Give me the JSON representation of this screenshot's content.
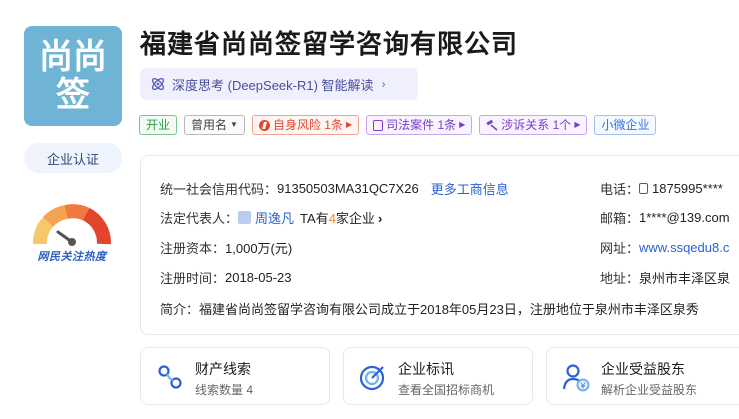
{
  "logo": {
    "text": "尚尚签"
  },
  "cert_label": "企业认证",
  "heat_label": "网民关注热度",
  "company_name": "福建省尚尚签留学咨询有限公司",
  "ai": {
    "label": "深度思考 (DeepSeek-R1) 智能解读",
    "chevron": "›"
  },
  "tags": {
    "status": "开业",
    "former_name": "曾用名",
    "risk": "自身风险 1条",
    "judicial": "司法案件 1条",
    "litigation": "涉诉关系 1个",
    "scale": "小微企业"
  },
  "info": {
    "credit_code_label": "统一社会信用代码：",
    "credit_code": "91350503MA31QC7X26",
    "more_link": "更多工商信息",
    "legal_rep_label": "法定代表人：",
    "legal_rep": "周逸凡",
    "ta_prefix": "TA有",
    "ta_count": "4",
    "ta_suffix": "家企业",
    "capital_label": "注册资本：",
    "capital": "1,000万(元)",
    "reg_date_label": "注册时间：",
    "reg_date": "2018-05-23",
    "phone_label": "电话：",
    "phone": "1875995****",
    "email_label": "邮箱：",
    "email": "1****@139.com",
    "website_label": "网址：",
    "website": "www.ssqedu8.c",
    "address_label": "地址：",
    "address": "泉州市丰泽区泉",
    "intro_label": "简介：",
    "intro": "福建省尚尚签留学咨询有限公司成立于2018年05月23日，注册地位于泉州市丰泽区泉秀"
  },
  "features": [
    {
      "title": "财产线索",
      "sub": "线索数量 4"
    },
    {
      "title": "企业标讯",
      "sub": "查看全国招标商机"
    },
    {
      "title": "企业受益股东",
      "sub": "解析企业受益股东"
    }
  ],
  "colors": {
    "accent": "#2a62d6",
    "logo_bg": "#6fb4d4",
    "highlight": "#f08a24"
  }
}
